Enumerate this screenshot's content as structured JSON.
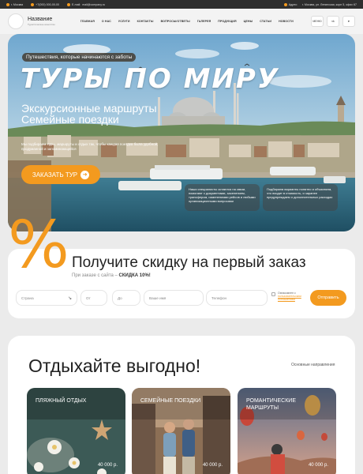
{
  "topbar": {
    "city": "г. Москва",
    "phone": "+7(000) 000-00-00",
    "email_label": "E-mail:",
    "email": "mail@company.ru",
    "address_label": "Адрес:",
    "address": "г. Москва, ул. Ленинская, корп 5, офис 67",
    "accent_color": "#f39a1f"
  },
  "header": {
    "name": "Название",
    "subtitle": "Туристическое агентство",
    "nav": [
      "ГЛАВНАЯ",
      "О НАС",
      "УСЛУГИ",
      "КОНТАКТЫ",
      "ВОПРОСЫ/ОТВЕТЫ",
      "ГАЛЕРЕЯ",
      "ПРОДУКЦИЯ",
      "ЦЕНЫ",
      "СТАТЬИ",
      "НОВОСТИ"
    ],
    "menu_label": "МЕНЮ",
    "icons": [
      "vk-icon",
      "telegram-icon"
    ]
  },
  "hero": {
    "tagline": "Путешествия, которые начинаются с заботы",
    "title": "ТУРЫ ПО МИРУ",
    "subtitle_1": "Экскурсионные маршруты",
    "subtitle_2": "Семейные поездки",
    "description": "Мы подбираем туры, маршруты и отдых так, чтобы каждая поездка была удобной, продуманной и запоминающейся",
    "button_label": "ЗАКАЗАТЬ ТУР",
    "card_1": "Наши специалисты остаются на связи, помогают с документами, заселением, трансфером, изменениями рейсов и любыми организационными вопросами",
    "card_2": "Подбираем варианты понятно и объясняем, что входит в стоимость, и заранее предупреждаем о дополнительных расходах"
  },
  "discount": {
    "symbol": "%",
    "title": "Получите скидку на первый заказ",
    "subtitle": "При заказе с сайта –",
    "discount_value": "СКИДКА 10%!",
    "fields": {
      "country": "Страна",
      "from": "От",
      "to": "До",
      "name": "Ваше имя",
      "phone": "Телефон"
    },
    "consent_text": "Ознакомлен с",
    "consent_link": "пользовательским соглашением",
    "submit_label": "Отправить"
  },
  "benefit": {
    "title": "Отдыхайте выгодно!",
    "link": "Основные направления",
    "cards": [
      {
        "title": "ПЛЯЖНЫЙ ОТДЫХ",
        "price": "40 000 р."
      },
      {
        "title": "СЕМЕЙНЫЕ ПОЕЗДКИ",
        "price": "40 000 р."
      },
      {
        "title": "РОМАНТИЧЕСКИЕ МАРШРУТЫ",
        "price": "40 000 р."
      }
    ]
  }
}
